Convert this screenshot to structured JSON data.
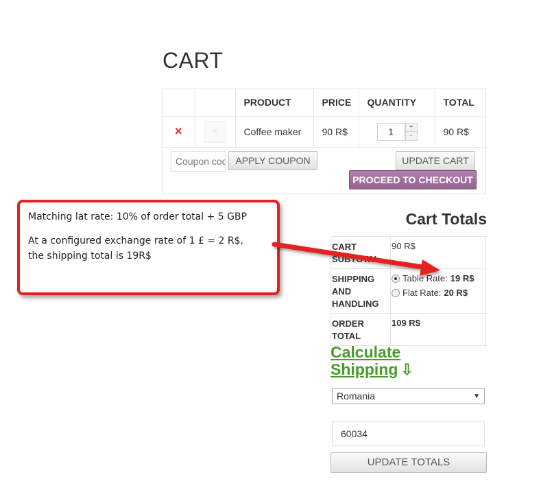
{
  "page": {
    "title": "CART"
  },
  "cart": {
    "columns": [
      "",
      "",
      "PRODUCT",
      "PRICE",
      "QUANTITY",
      "TOTAL"
    ],
    "items": [
      {
        "remove": "×",
        "product": "Coffee maker",
        "price": "90 R$",
        "quantity": "1",
        "total": "90 R$"
      }
    ],
    "qty_plus": "+",
    "qty_minus": "-",
    "coupon_placeholder": "Coupon code",
    "apply_coupon": "APPLY COUPON",
    "update_cart": "UPDATE CART",
    "proceed_checkout": "PROCEED TO CHECKOUT"
  },
  "totals": {
    "title": "Cart Totals",
    "subtotal_label": "CART SUBTOTAL",
    "subtotal_value": "90 R$",
    "shipping_label": "SHIPPING AND HANDLING",
    "shipping_options": [
      {
        "label": "Table Rate:",
        "amount": "19 R$",
        "selected": true
      },
      {
        "label": "Flat Rate:",
        "amount": "20 R$",
        "selected": false
      }
    ],
    "order_total_label": "ORDER TOTAL",
    "order_total_value": "109 R$"
  },
  "shipping_calc": {
    "link": "Calculate Shipping",
    "arrow_icon": "arrow-down-icon",
    "country": "Romania",
    "postcode": "60034",
    "update_totals": "UPDATE TOTALS"
  },
  "annotation": {
    "line1": "Matching lat rate: 10% of order total +   5 GBP",
    "line2": "At a configured exchange rate of 1 £ = 2 R$,",
    "line3": "the shipping total is 19R$",
    "border_color": "#e42020"
  },
  "colors": {
    "remove": "#e0211a",
    "checkout": "#a46e9f",
    "calc_link": "#4a9c2a"
  }
}
